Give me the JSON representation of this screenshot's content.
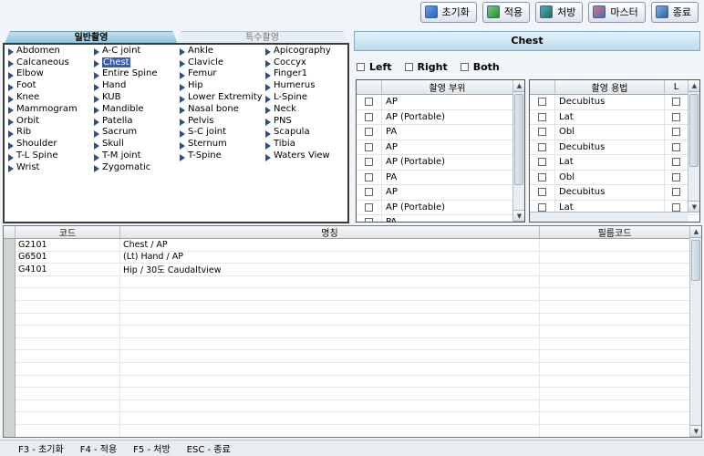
{
  "toolbar": {
    "reset": "초기화",
    "apply": "적용",
    "prescribe": "처방",
    "master": "마스터",
    "exit": "종료"
  },
  "tabs": {
    "general": "일반촬영",
    "special": "특수촬영"
  },
  "body_parts": {
    "col1": [
      "Abdomen",
      "Calcaneous",
      "Elbow",
      "Foot",
      "Knee",
      "Mammogram",
      "Orbit",
      "Rib",
      "Shoulder",
      "T-L Spine",
      "Wrist"
    ],
    "col2": [
      "A-C joint",
      "Chest",
      "Entire Spine",
      "Hand",
      "KUB",
      "Mandible",
      "Patella",
      "Sacrum",
      "Skull",
      "T-M joint",
      "Zygomatic"
    ],
    "col3": [
      "Ankle",
      "Clavicle",
      "Femur",
      "Hip",
      "Lower Extremity",
      "Nasal bone",
      "Pelvis",
      "S-C joint",
      "Sternum",
      "T-Spine"
    ],
    "col4": [
      "Apicography",
      "Coccyx",
      "Finger1",
      "Humerus",
      "L-Spine",
      "Neck",
      "PNS",
      "Scapula",
      "Tibia",
      "Waters View"
    ],
    "selected": "Chest"
  },
  "detail": {
    "title": "Chest",
    "side_left": "Left",
    "side_right": "Right",
    "side_both": "Both"
  },
  "position_grid": {
    "header": "촬영 부위",
    "rows": [
      "AP",
      "AP (Portable)",
      "PA",
      "AP",
      "AP (Portable)",
      "PA",
      "AP",
      "AP (Portable)",
      "PA"
    ]
  },
  "method_grid": {
    "header": "촬영 용법",
    "header_l": "L",
    "rows": [
      "Decubitus",
      "Lat",
      "Obl",
      "Decubitus",
      "Lat",
      "Obl",
      "Decubitus",
      "Lat"
    ]
  },
  "orders": {
    "headers": {
      "code": "코드",
      "name": "명칭",
      "film": "필름코드"
    },
    "rows": [
      {
        "code": "G2101",
        "name": "Chest / AP",
        "film": ""
      },
      {
        "code": "G6501",
        "name": "(Lt) Hand / AP",
        "film": ""
      },
      {
        "code": "G4101",
        "name": "Hip / 30도 Caudaltview",
        "film": ""
      }
    ]
  },
  "status": {
    "f3": "F3 - 초기화",
    "f4": "F4 - 적용",
    "f5": "F5 - 처방",
    "esc": "ESC - 종료"
  }
}
